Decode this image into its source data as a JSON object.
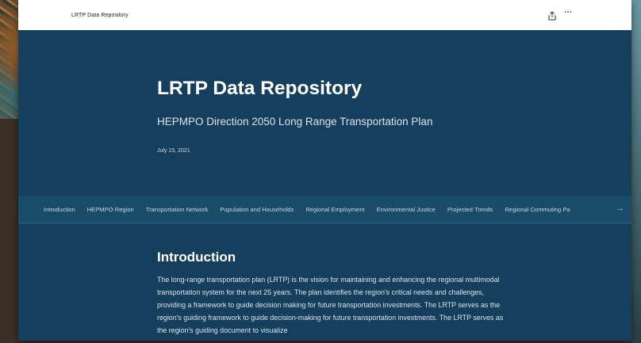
{
  "topbar": {
    "app_title": "LRTP Data Repository",
    "more_label": "⋯"
  },
  "hero": {
    "title": "LRTP Data Repository",
    "subtitle": "HEPMPO Direction 2050 Long Range Transportation Plan",
    "date": "July 15, 2021"
  },
  "nav": {
    "tabs": [
      {
        "label": "Introduction"
      },
      {
        "label": "HEPMPO Region"
      },
      {
        "label": "Transportation Network"
      },
      {
        "label": "Population and Households"
      },
      {
        "label": "Regional Employment"
      },
      {
        "label": "Environmental Justice"
      },
      {
        "label": "Projected Trends"
      },
      {
        "label": "Regional Commuting Pa"
      }
    ],
    "arrow": "→"
  },
  "section": {
    "heading": "Introduction",
    "body": "The long-range transportation plan (LRTP) is the vision for maintaining and enhancing the regional multimodal transportation system for the next 25 years. The plan identifies the region's critical needs and challenges, providing a framework to guide decision making for future transportation investments. The LRTP serves as the region's guiding framework to guide decision-making for future transportation investments. The LRTP serves as the region's guiding document to visualize"
  },
  "colors": {
    "hero_bg": "#153f5c",
    "nav_bg": "#1a4b69"
  }
}
